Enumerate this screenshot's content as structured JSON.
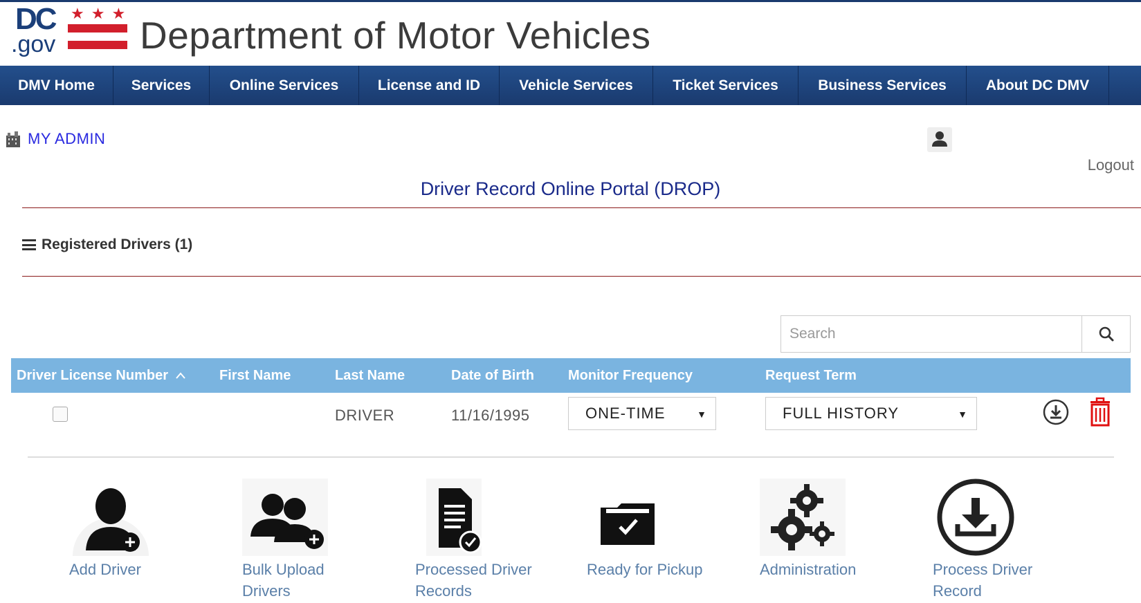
{
  "header": {
    "logo_dc": "DC",
    "logo_gov": ".gov",
    "logo_stars": "★★★",
    "title": "Department of Motor Vehicles"
  },
  "nav": {
    "items": [
      {
        "label": "DMV Home"
      },
      {
        "label": "Services"
      },
      {
        "label": "Online Services"
      },
      {
        "label": "License and ID"
      },
      {
        "label": "Vehicle Services"
      },
      {
        "label": "Ticket Services"
      },
      {
        "label": "Business Services"
      },
      {
        "label": "About DC DMV"
      }
    ]
  },
  "admin": {
    "label": "MY ADMIN"
  },
  "logout": "Logout",
  "portal_title": "Driver Record Online Portal (DROP)",
  "section": {
    "title": "Registered Drivers (1)"
  },
  "search": {
    "placeholder": "Search",
    "value": ""
  },
  "table": {
    "headers": [
      "Driver License Number",
      "First Name",
      "Last Name",
      "Date of Birth",
      "Monitor Frequency",
      "Request Term"
    ],
    "sort_indicator": "^",
    "rows": [
      {
        "license_number": "",
        "first_name": "",
        "last_name": "DRIVER",
        "dob": "11/16/1995",
        "monitor_frequency": "ONE-TIME",
        "request_term": "FULL HISTORY"
      }
    ]
  },
  "actions": [
    {
      "label": "Add Driver",
      "icon": "add-user-icon"
    },
    {
      "label": "Bulk Upload Drivers",
      "icon": "group-add-icon"
    },
    {
      "label": "Processed Driver Records",
      "icon": "document-check-icon"
    },
    {
      "label": "Ready for Pickup",
      "icon": "folder-check-icon"
    },
    {
      "label": "Administration",
      "icon": "gears-icon"
    },
    {
      "label": "Process Driver Record",
      "icon": "download-circle-icon"
    }
  ],
  "colors": {
    "nav_bg": "#1a3a6e",
    "table_header_bg": "#7ab4e0",
    "brand_red": "#d21f2c",
    "link_blue": "#2a2ae0",
    "action_label": "#5a7fa8"
  }
}
